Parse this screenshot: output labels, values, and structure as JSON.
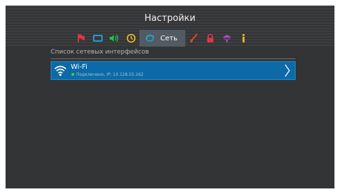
{
  "header": {
    "title": "Настройки"
  },
  "tabs": [
    {
      "icon": "flag-icon",
      "color": "#e8344a"
    },
    {
      "icon": "screen-icon",
      "color": "#1f9ad6"
    },
    {
      "icon": "speaker-icon",
      "color": "#22c24a"
    },
    {
      "icon": "clock-icon",
      "color": "#f2c21a"
    },
    {
      "icon": "network-icon",
      "color": "#1fa7d6",
      "label": "Сеть",
      "active": true
    },
    {
      "icon": "brush-icon",
      "color": "#e8462a"
    },
    {
      "icon": "lock-icon",
      "color": "#e8344a"
    },
    {
      "icon": "parachute-icon",
      "color": "#a64fc8"
    },
    {
      "icon": "info-icon",
      "color": "#f2c21a"
    }
  ],
  "section": {
    "label": "Список сетевых интерфейсов"
  },
  "interfaces": [
    {
      "name": "Wi-Fi",
      "status": "Подключено, IP: 10.128.55.162",
      "status_color": "#3fd43f",
      "icon": "wifi-icon",
      "selected": true
    }
  ],
  "colors": {
    "background": "#333436",
    "accent": "#0d6aa6"
  }
}
